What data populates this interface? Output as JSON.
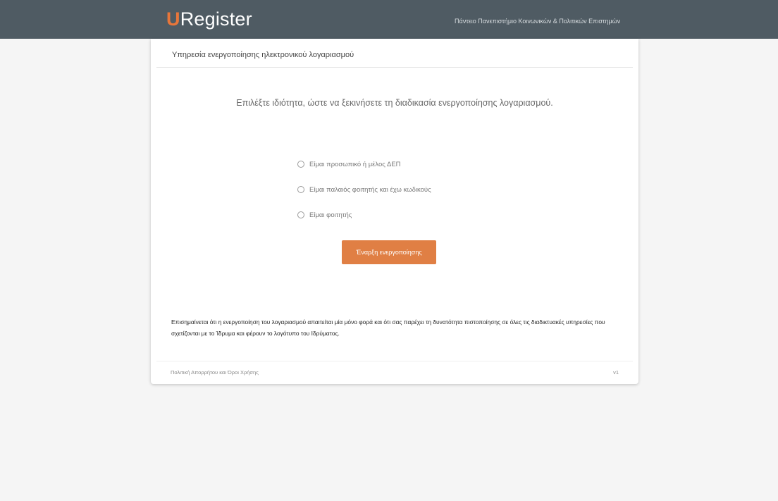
{
  "header": {
    "brand_first": "U",
    "brand_rest": "Register",
    "university": "Πάντειο Πανεπιστήμιο Κοινωνικών & Πολιτικών Επιστημών",
    "brand_accent_color": "#e8763a",
    "bar_color": "#4f5b63"
  },
  "card": {
    "title": "Υπηρεσία ενεργοποίησης ηλεκτρονικού λογαριασμού",
    "prompt": "Επιλέξτε ιδιότητα, ώστε να ξεκινήσετε τη διαδικασία ενεργοποίησης λογαριασμού.",
    "options": [
      {
        "label": "Είμαι προσωπικό ή μέλος ΔΕΠ",
        "selected": false
      },
      {
        "label": "Είμαι παλαιός φοιτητής και έχω κωδικούς",
        "selected": false
      },
      {
        "label": "Είμαι φοιτητής",
        "selected": false
      }
    ],
    "start_button": "Έναρξη ενεργοποίησης",
    "button_color": "#e07f44",
    "notice": "Επισημαίνεται ότι η ενεργοποίηση του λογαριασμού απαιτείται μία μόνο φορά και ότι σας παρέχει τη δυνατότητα πιστοποίησης σε όλες τις διαδικτυακές υπηρεσίες που σχετίζονται με το Ίδρυμα και φέρουν το λογότυπο του Ιδρύματος."
  },
  "footer": {
    "link": "Πολιτική Απορρήτου και Όροι Χρήσης",
    "version": "v1"
  }
}
